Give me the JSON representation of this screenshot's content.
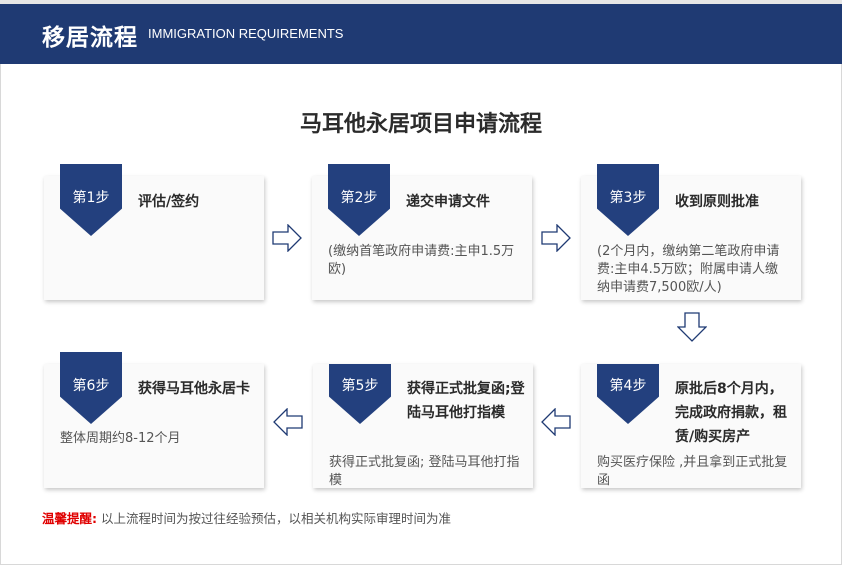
{
  "header": {
    "title": "移居流程",
    "subtitle": "IMMIGRATION REQUIREMENTS"
  },
  "page_title": "马耳他永居项目申请流程",
  "steps": [
    {
      "badge": "第1步",
      "title": "评估/签约",
      "desc": ""
    },
    {
      "badge": "第2步",
      "title": "递交申请文件",
      "desc": "(缴纳首笔政府申请费:主申1.5万欧)"
    },
    {
      "badge": "第3步",
      "title": "收到原则批准",
      "desc": "(2个月内，缴纳第二笔政府申请费:主申4.5万欧；附属申请人缴纳申请费7,500欧/人)"
    },
    {
      "badge": "第4步",
      "title": "原批后8个月内，完成政府捐款，租赁/购买房产",
      "desc": "购买医疗保险 ,并且拿到正式批复函"
    },
    {
      "badge": "第5步",
      "title": "获得正式批复函;登陆马耳他打指模",
      "desc": "获得正式批复函; 登陆马耳他打指模"
    },
    {
      "badge": "第6步",
      "title": "获得马耳他永居卡",
      "desc": "整体周期约8-12个月"
    }
  ],
  "notice": {
    "label": "温馨提醒:",
    "text": "以上流程时间为按过往经验预估，以相关机构实际审理时间为准"
  },
  "colors": {
    "header_bg": "#1f3a73",
    "badge_bg": "#23407e",
    "notice_label": "#e00000"
  },
  "icons": {
    "arrow_right": "arrow-right-icon",
    "arrow_down": "arrow-down-icon",
    "arrow_left": "arrow-left-icon"
  }
}
